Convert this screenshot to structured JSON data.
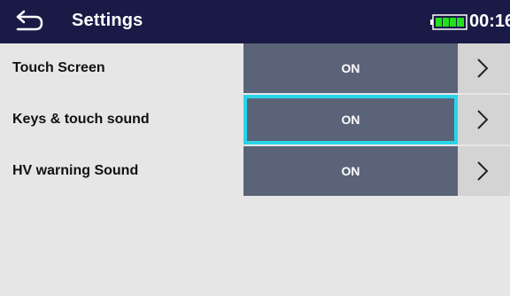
{
  "header": {
    "title": "Settings",
    "time": "00:16",
    "back_icon": "back-arrow-icon",
    "battery_icon": "battery-full-icon"
  },
  "settings": [
    {
      "label": "Touch Screen",
      "value": "ON",
      "selected": false
    },
    {
      "label": "Keys & touch sound",
      "value": "ON",
      "selected": true
    },
    {
      "label": "HV warning Sound",
      "value": "ON",
      "selected": false
    }
  ],
  "colors": {
    "header_bg": "#1a1a47",
    "value_bg": "#5b6378",
    "selection": "#29d4e8",
    "screen_bg": "#e6e6e6"
  }
}
